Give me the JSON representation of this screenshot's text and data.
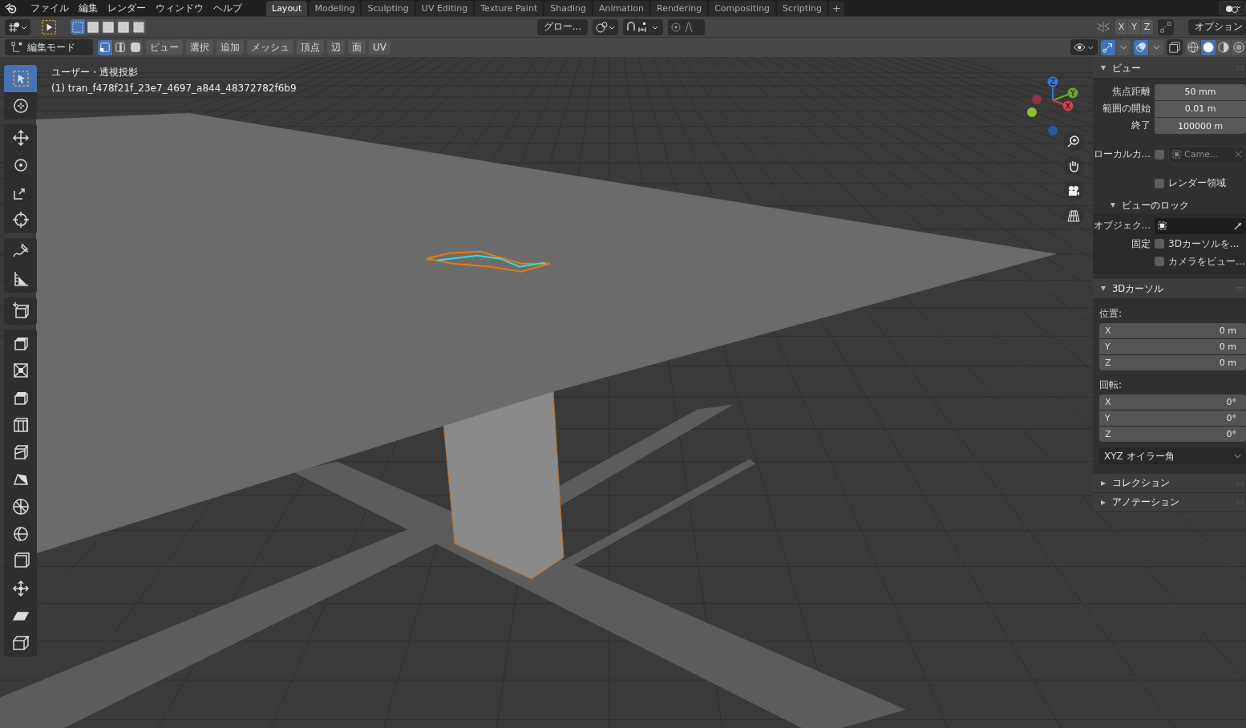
{
  "top_bar": {
    "menus": [
      "ファイル",
      "編集",
      "レンダー",
      "ウィンドウ",
      "ヘルプ"
    ],
    "workspaces": [
      {
        "label": "Layout",
        "selected": true
      },
      {
        "label": "Modeling",
        "selected": false
      },
      {
        "label": "Sculpting",
        "selected": false
      },
      {
        "label": "UV Editing",
        "selected": false
      },
      {
        "label": "Texture Paint",
        "selected": false
      },
      {
        "label": "Shading",
        "selected": false
      },
      {
        "label": "Animation",
        "selected": false
      },
      {
        "label": "Rendering",
        "selected": false
      },
      {
        "label": "Compositing",
        "selected": false
      },
      {
        "label": "Scripting",
        "selected": false
      }
    ],
    "add_workspace": "+"
  },
  "tool_header": {
    "select_modes": [
      {
        "selected": true
      },
      {
        "selected": false
      },
      {
        "selected": false
      },
      {
        "selected": false
      },
      {
        "selected": false
      }
    ],
    "transform_orientation": "グロー...",
    "axes": [
      "X",
      "Y",
      "Z"
    ],
    "options": "オプション"
  },
  "header": {
    "mode": "編集モード",
    "select_elements": [
      {
        "selected": true
      },
      {
        "selected": false
      },
      {
        "selected": false
      }
    ],
    "menus": [
      "ビュー",
      "選択",
      "追加",
      "メッシュ",
      "頂点",
      "辺",
      "面",
      "UV"
    ],
    "shading_modes": [
      {
        "selected": false
      },
      {
        "selected": true
      },
      {
        "selected": false
      },
      {
        "selected": false
      }
    ]
  },
  "viewport": {
    "view_name": "ユーザー・透視投影",
    "object_name": "(1) tran_f478f21f_23e7_4697_a844_48372782f6b9",
    "gizmo_axes": [
      {
        "label": "Z",
        "color": "#2f7be0"
      },
      {
        "label": "Y",
        "color": "#6ea52a"
      },
      {
        "label": "X",
        "color": "#e0374d"
      }
    ]
  },
  "toolbar": {
    "tool_groups": [
      [
        {
          "kind": "select_box",
          "selected": true
        },
        {
          "kind": "cursor",
          "selected": false
        }
      ],
      [
        {
          "kind": "move",
          "selected": false
        },
        {
          "kind": "rotate",
          "selected": false
        },
        {
          "kind": "scale",
          "selected": false
        },
        {
          "kind": "transform",
          "selected": false
        }
      ],
      [
        {
          "kind": "annotate",
          "selected": false
        },
        {
          "kind": "measure",
          "selected": false
        }
      ],
      [
        {
          "kind": "add_cube",
          "selected": false
        }
      ],
      [
        {
          "kind": "extrude",
          "selected": false
        },
        {
          "kind": "inset",
          "selected": false
        },
        {
          "kind": "bevel",
          "selected": false
        },
        {
          "kind": "loop_cut",
          "selected": false
        },
        {
          "kind": "knife",
          "selected": false
        },
        {
          "kind": "poly_build",
          "selected": false
        },
        {
          "kind": "spin",
          "selected": false
        },
        {
          "kind": "smooth",
          "selected": false
        },
        {
          "kind": "edge_slide",
          "selected": false
        },
        {
          "kind": "shrink",
          "selected": false
        },
        {
          "kind": "shear",
          "selected": false
        },
        {
          "kind": "rip",
          "selected": false
        }
      ]
    ]
  },
  "sidebar": {
    "view_panel": {
      "title": "ビュー",
      "expanded": true,
      "fields": [
        {
          "label": "焦点距離",
          "value": "50 mm"
        },
        {
          "label": "範囲の開始",
          "value": "0.01 m"
        },
        {
          "label": "終了",
          "value": "100000 m"
        }
      ],
      "local_camera": {
        "label": "ローカルカ...",
        "checked": false,
        "value": "Came...",
        "disabled": true
      },
      "render_region": {
        "label": "レンダー領域",
        "checked": false
      },
      "lock": {
        "title": "ビューのロック",
        "expanded": true,
        "object_label": "オブジェク...",
        "lock_label": "固定",
        "options": [
          {
            "label": "3Dカーソルを...",
            "checked": false
          },
          {
            "label": "カメラをビュー...",
            "checked": false
          }
        ]
      }
    },
    "cursor_panel": {
      "title": "3Dカーソル",
      "expanded": true,
      "location_label": "位置:",
      "location": [
        {
          "axis": "X",
          "value": "0 m"
        },
        {
          "axis": "Y",
          "value": "0 m"
        },
        {
          "axis": "Z",
          "value": "0 m"
        }
      ],
      "rotation_label": "回転:",
      "rotation": [
        {
          "axis": "X",
          "value": "0°"
        },
        {
          "axis": "Y",
          "value": "0°"
        },
        {
          "axis": "Z",
          "value": "0°"
        }
      ],
      "rotation_mode": "XYZ オイラー角"
    },
    "collapsed_panels": [
      {
        "title": "コレクション",
        "expanded": false
      },
      {
        "title": "アノテーション",
        "expanded": false
      }
    ]
  }
}
